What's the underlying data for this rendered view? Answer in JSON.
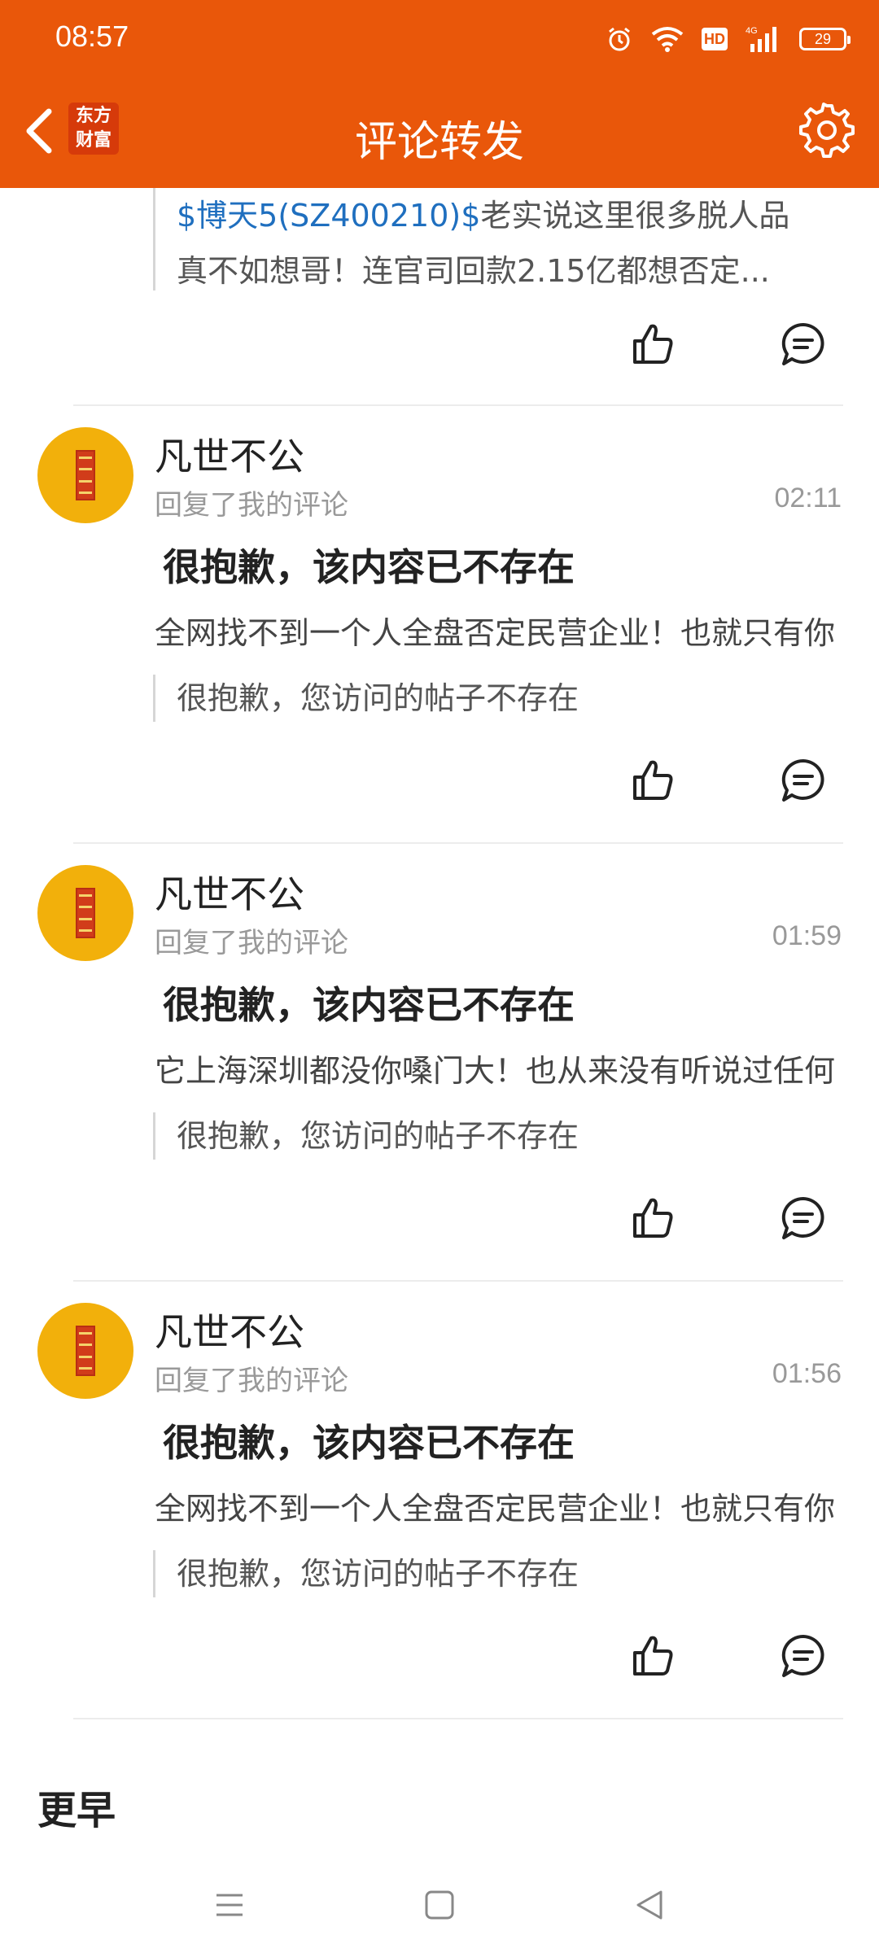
{
  "status": {
    "time": "08:57",
    "hd": "HD",
    "signal": "4G",
    "battery": "29"
  },
  "nav": {
    "logo_line1": "东方",
    "logo_line2": "财富",
    "title": "评论转发"
  },
  "top_quote": {
    "tag": "$博天5(SZ400210)$",
    "text": "老实说这里很多脱人品",
    "line2": "真不如想哥！连官司回款2.15亿都想否定..."
  },
  "items": [
    {
      "username": "凡世不公",
      "action": "回复了我的评论",
      "time": "02:11",
      "headline": "很抱歉，该内容已不存在",
      "body": "全网找不到一个人全盘否定民营企业！也就只有你",
      "quote": "很抱歉，您访问的帖子不存在"
    },
    {
      "username": "凡世不公",
      "action": "回复了我的评论",
      "time": "01:59",
      "headline": "很抱歉，该内容已不存在",
      "body": "它上海深圳都没你嗓门大！也从来没有听说过任何",
      "quote": "很抱歉，您访问的帖子不存在"
    },
    {
      "username": "凡世不公",
      "action": "回复了我的评论",
      "time": "01:56",
      "headline": "很抱歉，该内容已不存在",
      "body": "全网找不到一个人全盘否定民营企业！也就只有你",
      "quote": "很抱歉，您访问的帖子不存在"
    }
  ],
  "section": {
    "earlier": "更早"
  },
  "icons": {
    "back": "chevron-left-icon",
    "settings": "gear-icon",
    "like": "thumbs-up-icon",
    "comment": "comment-bubble-icon",
    "menu": "menu-icon",
    "home": "home-square-icon",
    "back_sys": "triangle-back-icon"
  },
  "colors": {
    "brand": "#e9570a",
    "tag": "#1f6fbf",
    "avatar": "#f2b00b"
  }
}
